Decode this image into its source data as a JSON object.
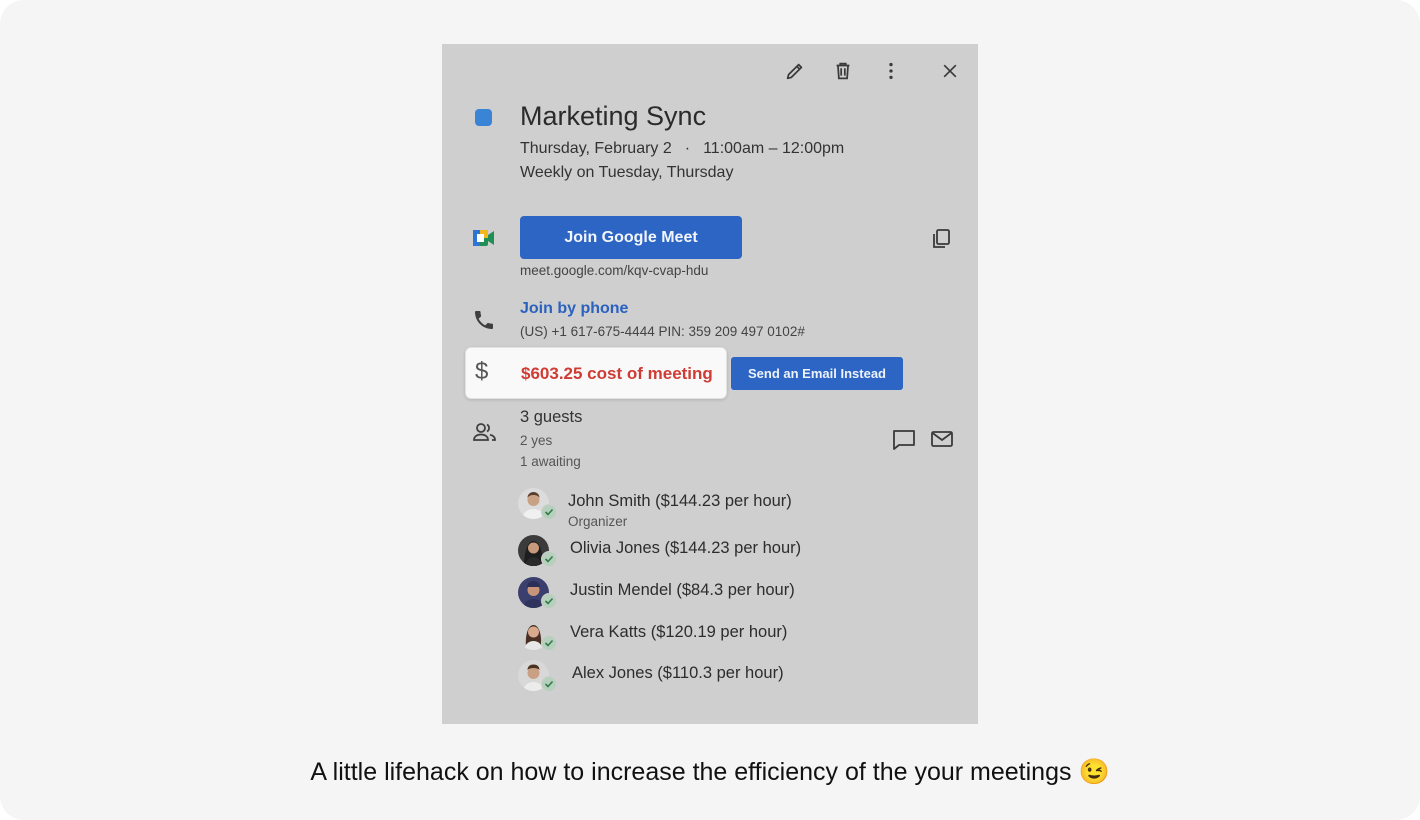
{
  "event": {
    "title": "Marketing Sync",
    "date": "Thursday, February 2",
    "separator": "·",
    "time": "11:00am – 12:00pm",
    "recurrence": "Weekly on Tuesday, Thursday",
    "color": "#3a84d6"
  },
  "toolbar": {
    "edit_icon": "pencil-icon",
    "delete_icon": "trash-icon",
    "more_icon": "more-vert-icon",
    "close_icon": "close-icon"
  },
  "meet": {
    "button_label": "Join Google Meet",
    "url": "meet.google.com/kqv-cvap-hdu"
  },
  "phone": {
    "link_label": "Join by phone",
    "details": "(US) +1 617-675-4444 PIN: 359 209 497 0102#"
  },
  "cost": {
    "symbol": "$",
    "text": "$603.25 cost of meeting",
    "email_button_label": "Send an Email Instead",
    "text_color": "#cf3b35"
  },
  "guests": {
    "title": "3 guests",
    "yes": "2 yes",
    "awaiting": "1 awaiting",
    "list": [
      {
        "name": "John Smith ($144.23 per hour)",
        "role": "Organizer"
      },
      {
        "name": "Olivia Jones ($144.23 per hour)"
      },
      {
        "name": "Justin Mendel ($84.3 per hour)"
      },
      {
        "name": "Vera Katts ($120.19 per hour)"
      },
      {
        "name": "Alex Jones ($110.3 per hour)"
      }
    ]
  },
  "accent_color": "#2c65c4",
  "caption": "A little lifehack on how to increase the efficiency of the your meetings 😉"
}
